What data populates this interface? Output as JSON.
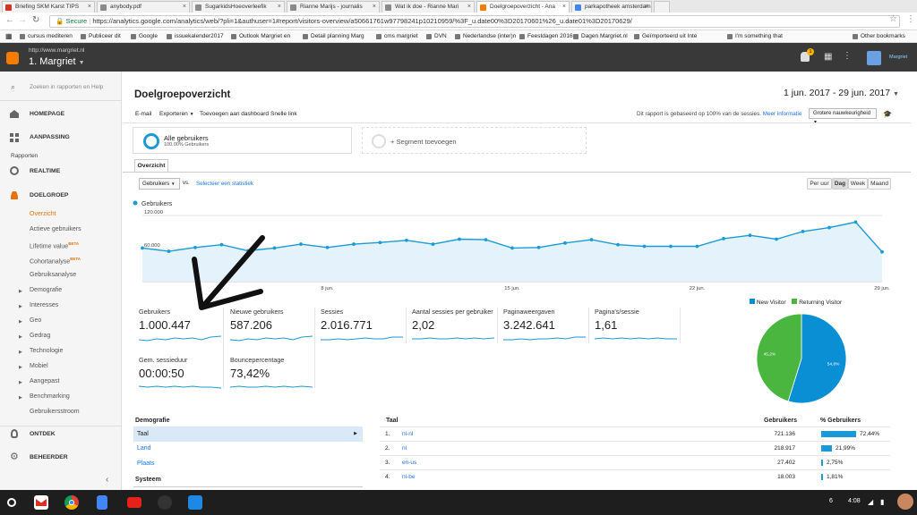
{
  "browser": {
    "tabs": [
      {
        "label": "Briefing SKM Karst TIPS",
        "color": "#d93025"
      },
      {
        "label": "anybody.pdf",
        "color": "#8a8a8a"
      },
      {
        "label": "SugarkidsHoeoverleefik",
        "color": "#8a8a8a"
      },
      {
        "label": "Rianne Marijs - journalis",
        "color": "#8a8a8a"
      },
      {
        "label": "Wat ik doe - Rianne Mari",
        "color": "#8a8a8a"
      },
      {
        "label": "Doelgroepoverzicht - Ana",
        "color": "#f57c00"
      },
      {
        "label": "parkapotheek amsterdam",
        "color": "#4285f4"
      }
    ],
    "secure_label": "Secure",
    "url": "https://analytics.google.com/analytics/web/?pli=1&authuser=1#report/visitors-overview/a50661761w97798241p10210959/%3F_u.date00%3D20170601%26_u.date01%3D20170629/",
    "bookmarks": [
      "cursus mediteren",
      "Publiceer dit",
      "Google",
      "issuekalender2017",
      "Outlook Margriet en",
      "Detail planning Marg",
      "cms margriet",
      "DVN",
      "Nederlandse (inter)n",
      "Feestdagen 2016",
      "Dagen Margriet.nl",
      "Geïmporteerd uit Inte",
      "I'm something that",
      "Other bookmarks"
    ]
  },
  "header": {
    "site_url": "http://www.margriet.nl",
    "account": "1. Margriet",
    "notif_count": "1",
    "user": "Margriet"
  },
  "sidebar": {
    "search_placeholder": "Zoeken in rapporten en Help",
    "home": "HOMEPAGE",
    "customize": "AANPASSING",
    "reports": "Rapporten",
    "realtime": "REALTIME",
    "audience": "DOELGROEP",
    "sub": [
      "Overzicht",
      "Actieve gebruikers",
      "Lifetime value",
      "Cohortanalyse",
      "Gebruiksanalyse"
    ],
    "beta": "BETA",
    "groups": [
      "Demografie",
      "Interesses",
      "Geo",
      "Gedrag",
      "Technologie",
      "Mobiel",
      "Aangepast",
      "Benchmarking"
    ],
    "userflow": "Gebruikersstroom",
    "discover": "ONTDEK",
    "admin": "BEHEERDER"
  },
  "report": {
    "title": "Doelgroepoverzicht",
    "date_range": "1 jun. 2017 - 29 jun. 2017",
    "toolbar": [
      "E-mail",
      "Exporteren",
      "Toevoegen aan dashboard",
      "Snelle link"
    ],
    "sampling_note": "Dit rapport is gebaseerd op 100% van de sessies.",
    "more_info": "Meer informatie",
    "precision": "Grotere nauwkeurigheid",
    "segment_name": "Alle gebruikers",
    "segment_pct": "100,00% Gebruikers",
    "add_segment": "+ Segment toevoegen",
    "tab_overview": "Overzicht",
    "metric_select": "Gebruikers",
    "vs": "vs.",
    "select_stat": "Selecteer een statistiek",
    "granularity": [
      "Per uur",
      "Dag",
      "Week",
      "Maand"
    ],
    "metrics": [
      {
        "label": "Gebruikers",
        "value": "1.000.447"
      },
      {
        "label": "Nieuwe gebruikers",
        "value": "587.206"
      },
      {
        "label": "Sessies",
        "value": "2.016.771"
      },
      {
        "label": "Aantal sessies per gebruiker",
        "value": "2,02"
      },
      {
        "label": "Paginaweergaven",
        "value": "3.242.641"
      },
      {
        "label": "Pagina's/sessie",
        "value": "1,61"
      },
      {
        "label": "Gem. sessieduur",
        "value": "00:00:50"
      },
      {
        "label": "Bouncepercentage",
        "value": "73,42%"
      }
    ],
    "pie_legend": [
      "New Visitor",
      "Returning Visitor"
    ],
    "demo_header": "Demografie",
    "demo_items": [
      "Taal",
      "Land",
      "Plaats"
    ],
    "system_header": "Systeem",
    "lang_table": {
      "headers": [
        "Taal",
        "Gebruikers",
        "% Gebruikers"
      ],
      "rows": [
        {
          "idx": "1.",
          "lang": "nl-nl",
          "users": "721.136",
          "pct": "72,44%",
          "frac": 0.7244
        },
        {
          "idx": "2.",
          "lang": "nl",
          "users": "218.917",
          "pct": "21,99%",
          "frac": 0.2199
        },
        {
          "idx": "3.",
          "lang": "en-us",
          "users": "27.402",
          "pct": "2,75%",
          "frac": 0.0275
        },
        {
          "idx": "4.",
          "lang": "nl-be",
          "users": "18.003",
          "pct": "1,81%",
          "frac": 0.0181
        }
      ]
    }
  },
  "chart_data": [
    {
      "type": "line",
      "legend": "Gebruikers",
      "ylim": [
        0,
        120000
      ],
      "y_tick_labels": [
        "120.000",
        "60.000"
      ],
      "x_tick_labels": [
        "8 jun.",
        "15 jun.",
        "22 jun.",
        "29 jun."
      ],
      "x": [
        "1 jun.",
        "2 jun.",
        "3 jun.",
        "4 jun.",
        "5 jun.",
        "6 jun.",
        "7 jun.",
        "8 jun.",
        "9 jun.",
        "10 jun.",
        "11 jun.",
        "12 jun.",
        "13 jun.",
        "14 jun.",
        "15 jun.",
        "16 jun.",
        "17 jun.",
        "18 jun.",
        "19 jun.",
        "20 jun.",
        "21 jun.",
        "22 jun.",
        "23 jun.",
        "24 jun.",
        "25 jun.",
        "26 jun.",
        "27 jun.",
        "28 jun.",
        "29 jun."
      ],
      "values": [
        61000,
        55000,
        62000,
        67000,
        56000,
        61000,
        68000,
        62000,
        68000,
        71000,
        75000,
        68000,
        77000,
        76000,
        61000,
        62000,
        70000,
        76000,
        67000,
        64000,
        64000,
        64000,
        78000,
        84000,
        77000,
        91000,
        98000,
        108000,
        54000
      ],
      "color": "#1a9bd7"
    },
    {
      "type": "pie",
      "labels": [
        "New Visitor",
        "Returning Visitor"
      ],
      "values": [
        54.8,
        45.2
      ],
      "slice_labels": [
        "54,8%",
        "45,2%"
      ],
      "colors": [
        "#0a8fd4",
        "#4ab640"
      ]
    }
  ],
  "taskbar": {
    "time": "4:08",
    "count": "6"
  }
}
